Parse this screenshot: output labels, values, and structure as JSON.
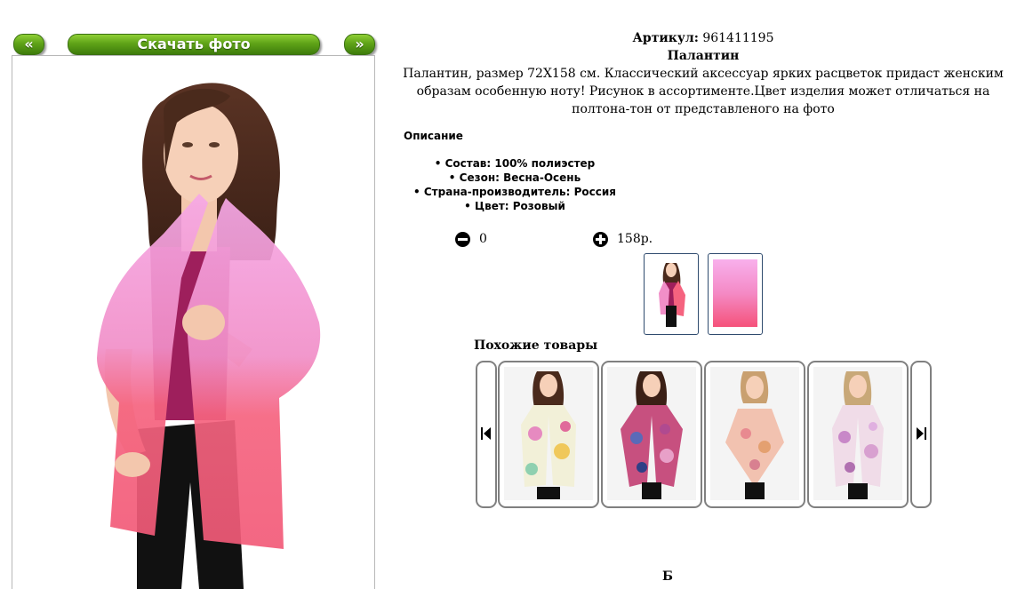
{
  "nav": {
    "prev_label": "«",
    "download_label": "Скачать фото",
    "next_label": "»"
  },
  "product": {
    "article_label": "Артикул:",
    "article_value": "961411195",
    "name": "Палантин",
    "description": "Палантин, размер 72Х158 см. Классический аксессуар ярких расцветок придаст женским образам особенную ноту! Рисунок в ассортименте.Цвет изделия может отличаться на полтона-тон от представленого на фото"
  },
  "details": {
    "title": "Описание",
    "specs": [
      "Состав: 100% полиэстер",
      "Сезон: Весна-Осень",
      "Страна-производитель: Россия",
      "Цвет: Розовый"
    ]
  },
  "order": {
    "quantity": "0",
    "price": "158р."
  },
  "similar": {
    "title": "Похожие товары"
  },
  "footer": {
    "text": "Б"
  },
  "colors": {
    "button_green": "#5fa318",
    "scarf_pink": "#f3a0dc",
    "scarf_coral": "#f25a80",
    "top_magenta": "#9e1f5c"
  }
}
